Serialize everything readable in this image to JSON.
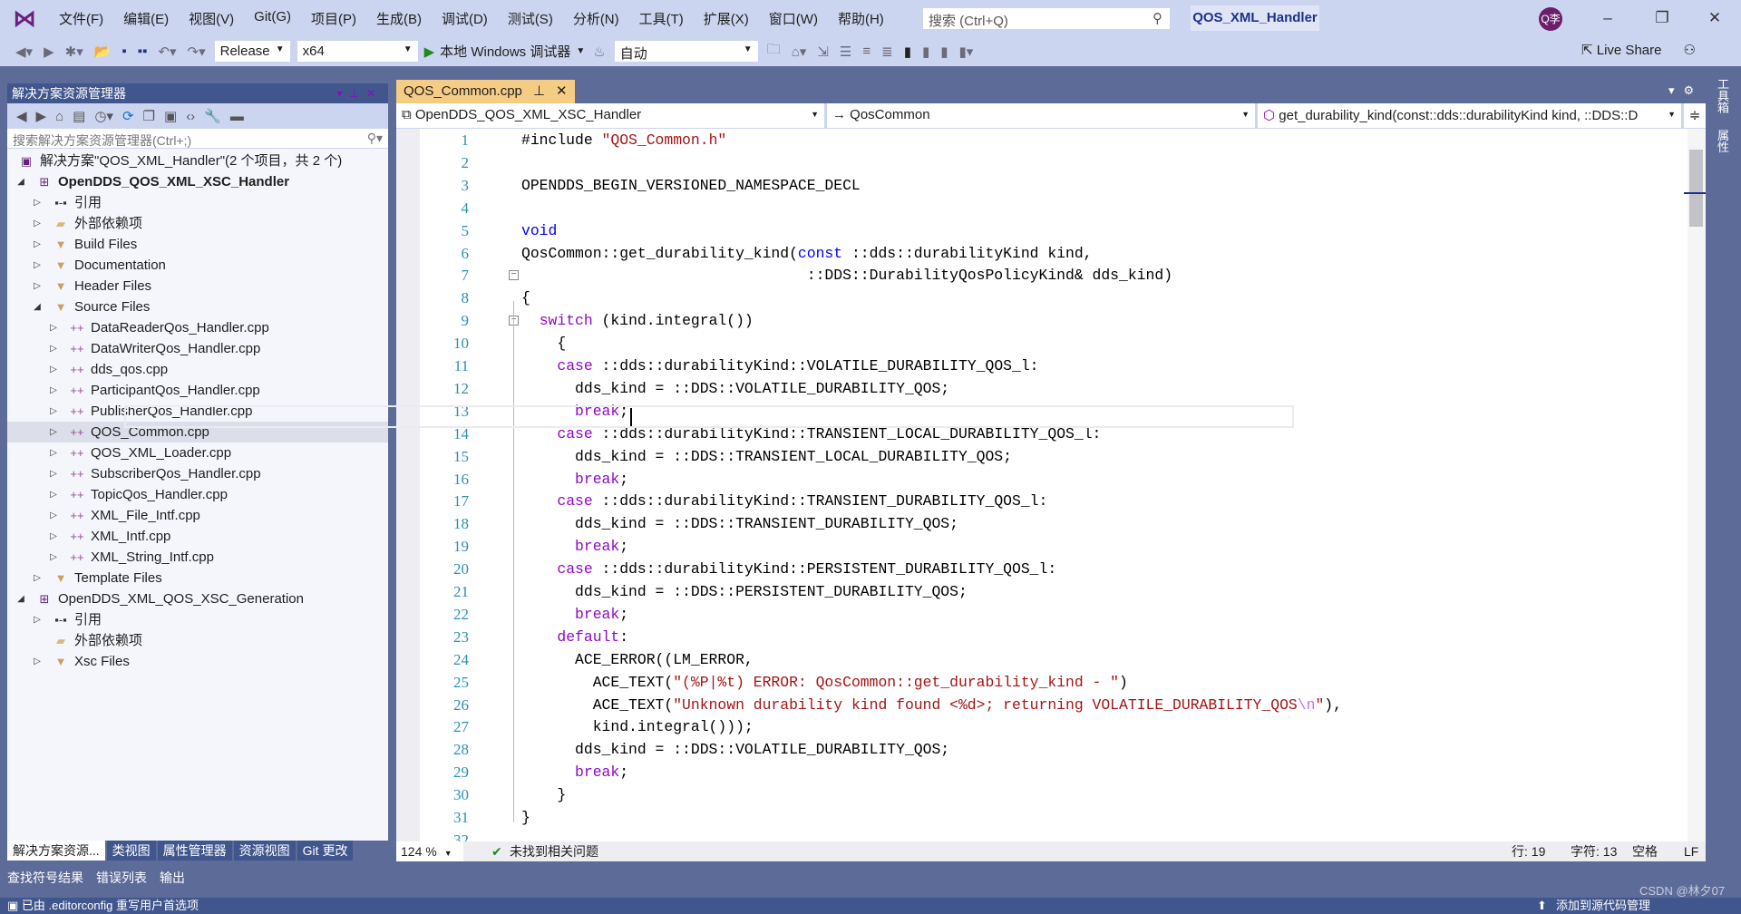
{
  "title": {
    "menu": [
      "文件(F)",
      "编辑(E)",
      "视图(V)",
      "Git(G)",
      "项目(P)",
      "生成(B)",
      "调试(D)",
      "测试(S)",
      "分析(N)",
      "工具(T)",
      "扩展(X)",
      "窗口(W)",
      "帮助(H)"
    ],
    "search_placeholder": "搜索 (Ctrl+Q)",
    "project": "QOS_XML_Handler",
    "avatar": "Q李"
  },
  "toolbar": {
    "config": "Release",
    "platform": "x64",
    "run_label": "本地 Windows 调试器",
    "auto": "自动",
    "live_share": "Live Share"
  },
  "solution_explorer": {
    "title": "解决方案资源管理器",
    "search_placeholder": "搜索解决方案资源管理器(Ctrl+;)",
    "items": [
      {
        "label": "解决方案\"QOS_XML_Handler\"(2 个项目，共 2 个)",
        "level": 0,
        "icon": "solution-icon",
        "arrow": ""
      },
      {
        "label": "OpenDDS_QOS_XML_XSC_Handler",
        "level": 1,
        "icon": "project-icon",
        "arrow": "expanded",
        "bold": true
      },
      {
        "label": "引用",
        "level": 2,
        "icon": "reference-icon",
        "arrow": "collapsed"
      },
      {
        "label": "外部依赖项",
        "level": 2,
        "icon": "external-deps-icon",
        "arrow": "collapsed"
      },
      {
        "label": "Build Files",
        "level": 2,
        "icon": "filter-folder-icon",
        "arrow": "collapsed"
      },
      {
        "label": "Documentation",
        "level": 2,
        "icon": "filter-folder-icon",
        "arrow": "collapsed"
      },
      {
        "label": "Header Files",
        "level": 2,
        "icon": "filter-folder-icon",
        "arrow": "collapsed"
      },
      {
        "label": "Source Files",
        "level": 2,
        "icon": "filter-folder-icon",
        "arrow": "expanded"
      },
      {
        "label": "DataReaderQos_Handler.cpp",
        "level": 3,
        "icon": "cpp-file-icon",
        "arrow": "collapsed"
      },
      {
        "label": "DataWriterQos_Handler.cpp",
        "level": 3,
        "icon": "cpp-file-icon",
        "arrow": "collapsed"
      },
      {
        "label": "dds_qos.cpp",
        "level": 3,
        "icon": "cpp-file-icon",
        "arrow": "collapsed"
      },
      {
        "label": "ParticipantQos_Handler.cpp",
        "level": 3,
        "icon": "cpp-file-icon",
        "arrow": "collapsed"
      },
      {
        "label": "PublisherQos_Handler.cpp",
        "level": 3,
        "icon": "cpp-file-icon",
        "arrow": "collapsed"
      },
      {
        "label": "QOS_Common.cpp",
        "level": 3,
        "icon": "cpp-file-icon",
        "arrow": "collapsed",
        "selected": true
      },
      {
        "label": "QOS_XML_Loader.cpp",
        "level": 3,
        "icon": "cpp-file-icon",
        "arrow": "collapsed"
      },
      {
        "label": "SubscriberQos_Handler.cpp",
        "level": 3,
        "icon": "cpp-file-icon",
        "arrow": "collapsed"
      },
      {
        "label": "TopicQos_Handler.cpp",
        "level": 3,
        "icon": "cpp-file-icon",
        "arrow": "collapsed"
      },
      {
        "label": "XML_File_Intf.cpp",
        "level": 3,
        "icon": "cpp-file-icon",
        "arrow": "collapsed"
      },
      {
        "label": "XML_Intf.cpp",
        "level": 3,
        "icon": "cpp-file-icon",
        "arrow": "collapsed"
      },
      {
        "label": "XML_String_Intf.cpp",
        "level": 3,
        "icon": "cpp-file-icon",
        "arrow": "collapsed"
      },
      {
        "label": "Template Files",
        "level": 2,
        "icon": "filter-folder-icon",
        "arrow": "collapsed"
      },
      {
        "label": "OpenDDS_XML_QOS_XSC_Generation",
        "level": 1,
        "icon": "project-icon",
        "arrow": "expanded"
      },
      {
        "label": "引用",
        "level": 2,
        "icon": "reference-icon",
        "arrow": "collapsed"
      },
      {
        "label": "外部依赖项",
        "level": 2,
        "icon": "external-deps-icon",
        "arrow": ""
      },
      {
        "label": "Xsc Files",
        "level": 2,
        "icon": "filter-folder-icon",
        "arrow": "collapsed"
      }
    ],
    "tabs": [
      "解决方案资源...",
      "类视图",
      "属性管理器",
      "资源视图",
      "Git 更改"
    ]
  },
  "editor": {
    "tab": "QOS_Common.cpp",
    "nav_project": "OpenDDS_QOS_XML_XSC_Handler",
    "nav_class": "QosCommon",
    "nav_member": "get_durability_kind(const::dds::durabilityKind kind, ::DDS::D",
    "lines": [
      [
        [
          "#include ",
          "pl"
        ],
        [
          "\"QOS_Common.h\"",
          "str"
        ]
      ],
      [],
      [
        [
          "OPENDDS_BEGIN_VERSIONED_NAMESPACE_DECL",
          "pl"
        ]
      ],
      [],
      [
        [
          "void",
          "kw"
        ]
      ],
      [
        [
          "QosCommon::get_durability_kind(",
          "pl"
        ],
        [
          "const",
          "kw"
        ],
        [
          " ::dds::durabilityKind kind,",
          "pl"
        ]
      ],
      [
        [
          "                                ::DDS::DurabilityQosPolicyKind& dds_kind)",
          "pl"
        ]
      ],
      [
        [
          "{",
          "pl"
        ]
      ],
      [
        [
          "  ",
          "pl"
        ],
        [
          "switch",
          "ctl"
        ],
        [
          " (kind.integral())",
          "pl"
        ]
      ],
      [
        [
          "    {",
          "pl"
        ]
      ],
      [
        [
          "    ",
          "pl"
        ],
        [
          "case",
          "ctl"
        ],
        [
          " ::dds::durabilityKind::VOLATILE_DURABILITY_QOS_l:",
          "pl"
        ]
      ],
      [
        [
          "      dds_kind = ::DDS::VOLATILE_DURABILITY_QOS;",
          "pl"
        ]
      ],
      [
        [
          "      ",
          "pl"
        ],
        [
          "break",
          "ctl"
        ],
        [
          ";",
          "pl"
        ]
      ],
      [
        [
          "    ",
          "pl"
        ],
        [
          "case",
          "ctl"
        ],
        [
          " ::dds::durabilityKind::TRANSIENT_LOCAL_DURABILITY_QOS_l:",
          "pl"
        ]
      ],
      [
        [
          "      dds_kind = ::DDS::TRANSIENT_LOCAL_DURABILITY_QOS;",
          "pl"
        ]
      ],
      [
        [
          "      ",
          "pl"
        ],
        [
          "break",
          "ctl"
        ],
        [
          ";",
          "pl"
        ]
      ],
      [
        [
          "    ",
          "pl"
        ],
        [
          "case",
          "ctl"
        ],
        [
          " ::dds::durabilityKind::TRANSIENT_DURABILITY_QOS_l:",
          "pl"
        ]
      ],
      [
        [
          "      dds_kind = ::DDS::TRANSIENT_DURABILITY_QOS;",
          "pl"
        ]
      ],
      [
        [
          "      ",
          "pl"
        ],
        [
          "break",
          "ctl"
        ],
        [
          ";",
          "pl"
        ]
      ],
      [
        [
          "    ",
          "pl"
        ],
        [
          "case",
          "ctl"
        ],
        [
          " ::dds::durabilityKind::PERSISTENT_DURABILITY_QOS_l:",
          "pl"
        ]
      ],
      [
        [
          "      dds_kind = ::DDS::PERSISTENT_DURABILITY_QOS;",
          "pl"
        ]
      ],
      [
        [
          "      ",
          "pl"
        ],
        [
          "break",
          "ctl"
        ],
        [
          ";",
          "pl"
        ]
      ],
      [
        [
          "    ",
          "pl"
        ],
        [
          "default",
          "ctl"
        ],
        [
          ":",
          "pl"
        ]
      ],
      [
        [
          "      ACE_ERROR((LM_ERROR,",
          "pl"
        ]
      ],
      [
        [
          "        ACE_TEXT(",
          "pl"
        ],
        [
          "\"(%P|%t) ERROR: QosCommon::get_durability_kind - \"",
          "str"
        ],
        [
          ")",
          "pl"
        ]
      ],
      [
        [
          "        ACE_TEXT(",
          "pl"
        ],
        [
          "\"Unknown durability kind found <%d>; returning VOLATILE_DURABILITY_QOS",
          "str"
        ],
        [
          "\\n",
          "esc"
        ],
        [
          "\"",
          "str"
        ],
        [
          "),",
          "pl"
        ]
      ],
      [
        [
          "        kind.integral()));",
          "pl"
        ]
      ],
      [
        [
          "      dds_kind = ::DDS::VOLATILE_DURABILITY_QOS;",
          "pl"
        ]
      ],
      [
        [
          "      ",
          "pl"
        ],
        [
          "break",
          "ctl"
        ],
        [
          ";",
          "pl"
        ]
      ],
      [
        [
          "    }",
          "pl"
        ]
      ],
      [
        [
          "}",
          "pl"
        ]
      ],
      []
    ]
  },
  "status": {
    "zoom": "124 %",
    "issues": "未找到相关问题",
    "line": "行: 19",
    "col": "字符: 13",
    "spaces": "空格",
    "eol": "LF"
  },
  "output_tabs": [
    "查找符号结果",
    "错误列表",
    "输出"
  ],
  "bottom": {
    "message": "已由 .editorconfig 重写用户首选项",
    "source_control": "添加到源代码管理",
    "watermark": "CSDN @林夕07"
  },
  "right_strip": [
    "工具箱",
    "属性"
  ],
  "colors": {
    "accent": "#68217a",
    "chrome": "#ccd5f0",
    "panel_header": "#40568d",
    "active_tab": "#f5cc84",
    "keyword": "#0000ff",
    "control": "#8f08c4",
    "string": "#a31515",
    "line_number": "#2b91af"
  }
}
